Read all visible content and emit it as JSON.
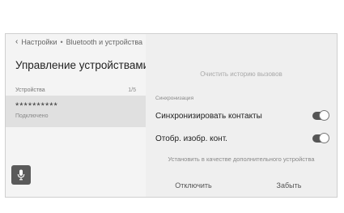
{
  "breadcrumb": {
    "back_icon": "chevron-left-icon",
    "item1": "Настройки",
    "separator": "•",
    "item2": "Bluetooth и устройства"
  },
  "left": {
    "title": "Управление устройствами",
    "devices_header": "Устройства",
    "devices_count": "1/5",
    "device": {
      "name": "**********",
      "status": "Подключено"
    },
    "mic_icon": "microphone-icon"
  },
  "right": {
    "clear_history": "Очистить историю вызовов",
    "sync_header": "Синхронизация",
    "sync_contacts": {
      "label": "Синхронизировать контакты",
      "on": true
    },
    "show_contact_images": {
      "label": "Отобр. изобр. конт.",
      "on": true
    },
    "set_aux": "Установить в качестве дополнительного устройства",
    "disconnect": "Отключить",
    "forget": "Забыть"
  },
  "colors": {
    "toggle_on": "#555555",
    "selected_row": "#e0e0e0"
  }
}
